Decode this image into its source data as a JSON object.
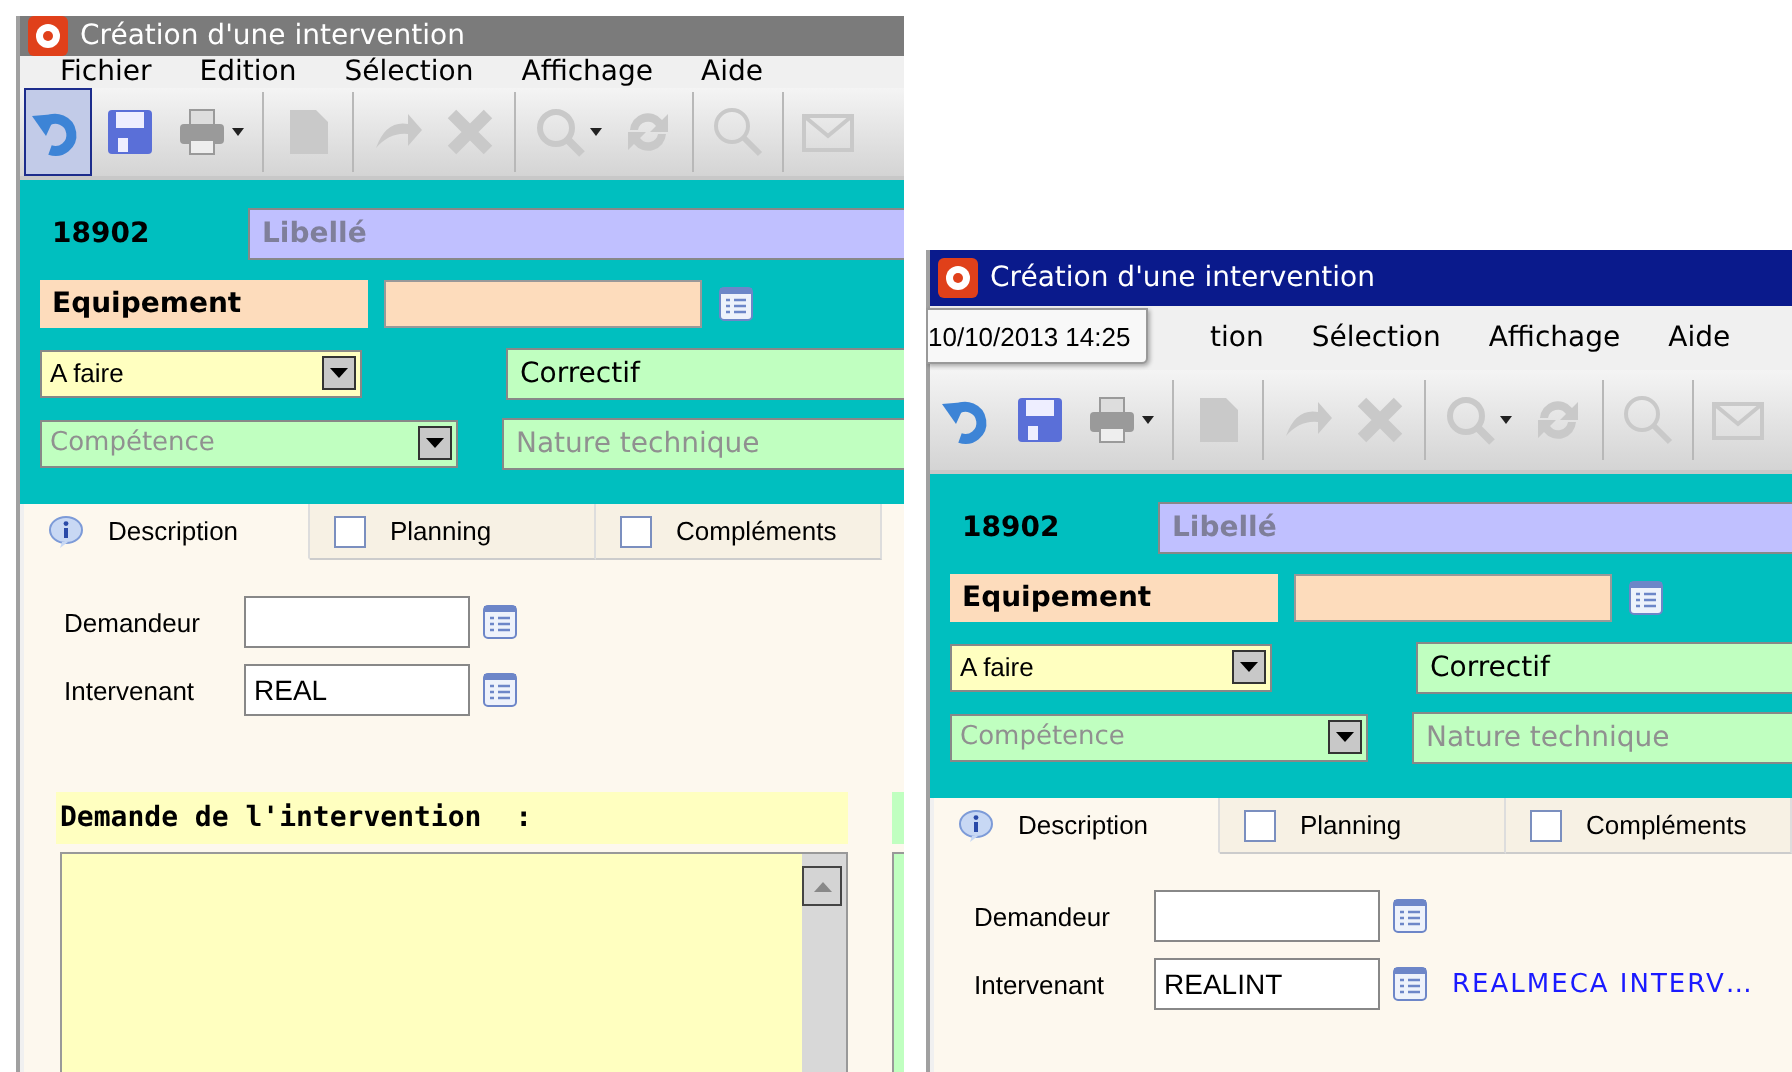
{
  "windows": [
    {
      "title": "Création d'une intervention",
      "active": false,
      "menu": [
        "Fichier",
        "Edition",
        "Sélection",
        "Affichage",
        "Aide"
      ],
      "toolbar": [
        {
          "kind": "undo",
          "disabled": false,
          "hovered": true,
          "dropdown": false
        },
        {
          "kind": "save",
          "disabled": false,
          "hovered": false,
          "dropdown": false
        },
        {
          "kind": "print",
          "disabled": false,
          "hovered": false,
          "dropdown": true
        },
        {
          "kind": "document",
          "disabled": true,
          "hovered": false,
          "dropdown": false
        },
        {
          "kind": "forward",
          "disabled": true,
          "hovered": false,
          "dropdown": false
        },
        {
          "kind": "delete",
          "disabled": true,
          "hovered": false,
          "dropdown": false
        },
        {
          "kind": "find",
          "disabled": true,
          "hovered": false,
          "dropdown": true
        },
        {
          "kind": "refresh",
          "disabled": true,
          "hovered": false,
          "dropdown": false
        },
        {
          "kind": "search",
          "disabled": true,
          "hovered": false,
          "dropdown": false
        },
        {
          "kind": "mail",
          "disabled": true,
          "hovered": false,
          "dropdown": false
        }
      ],
      "number": "18902",
      "libelle": {
        "placeholder": "Libellé"
      },
      "equipement": {
        "label": "Equipement"
      },
      "status": {
        "value": "A faire"
      },
      "type": {
        "value": "Correctif"
      },
      "competence": {
        "placeholder": "Compétence"
      },
      "nature": {
        "placeholder": "Nature technique"
      },
      "tabs": [
        {
          "label": "Description",
          "selected": true,
          "kind": "info"
        },
        {
          "label": "Planning",
          "selected": false,
          "kind": "checkbox",
          "checked": false
        },
        {
          "label": "Compléments",
          "selected": false,
          "kind": "checkbox",
          "checked": false
        }
      ],
      "demandeur": {
        "label": "Demandeur"
      },
      "intervenant": {
        "label": "Intervenant",
        "value": "REAL"
      },
      "demande": {
        "heading": "Demande de l'intervention  :"
      }
    },
    {
      "title": "Création d'une intervention",
      "active": true,
      "tooltip": "10/10/2013 14:25",
      "menu": [
        "tion",
        "Sélection",
        "Affichage",
        "Aide"
      ],
      "toolbar": [
        {
          "kind": "undo",
          "disabled": false,
          "hovered": false,
          "dropdown": false
        },
        {
          "kind": "save",
          "disabled": false,
          "hovered": false,
          "dropdown": false
        },
        {
          "kind": "print",
          "disabled": false,
          "hovered": false,
          "dropdown": true
        },
        {
          "kind": "document",
          "disabled": true,
          "hovered": false,
          "dropdown": false
        },
        {
          "kind": "forward",
          "disabled": true,
          "hovered": false,
          "dropdown": false
        },
        {
          "kind": "delete",
          "disabled": true,
          "hovered": false,
          "dropdown": false
        },
        {
          "kind": "find",
          "disabled": true,
          "hovered": false,
          "dropdown": true
        },
        {
          "kind": "refresh",
          "disabled": true,
          "hovered": false,
          "dropdown": false
        },
        {
          "kind": "search",
          "disabled": true,
          "hovered": false,
          "dropdown": false
        },
        {
          "kind": "mail",
          "disabled": true,
          "hovered": false,
          "dropdown": false
        }
      ],
      "number": "18902",
      "libelle": {
        "placeholder": "Libellé"
      },
      "equipement": {
        "label": "Equipement"
      },
      "status": {
        "value": "A faire"
      },
      "type": {
        "value": "Correctif"
      },
      "competence": {
        "placeholder": "Compétence"
      },
      "nature": {
        "placeholder": "Nature technique"
      },
      "tabs": [
        {
          "label": "Description",
          "selected": true,
          "kind": "info"
        },
        {
          "label": "Planning",
          "selected": false,
          "kind": "checkbox",
          "checked": false
        },
        {
          "label": "Compléments",
          "selected": false,
          "kind": "checkbox",
          "checked": false
        }
      ],
      "demandeur": {
        "label": "Demandeur"
      },
      "intervenant": {
        "label": "Intervenant",
        "value": "REALINT",
        "name": "REALMECA INTERV…"
      }
    }
  ]
}
